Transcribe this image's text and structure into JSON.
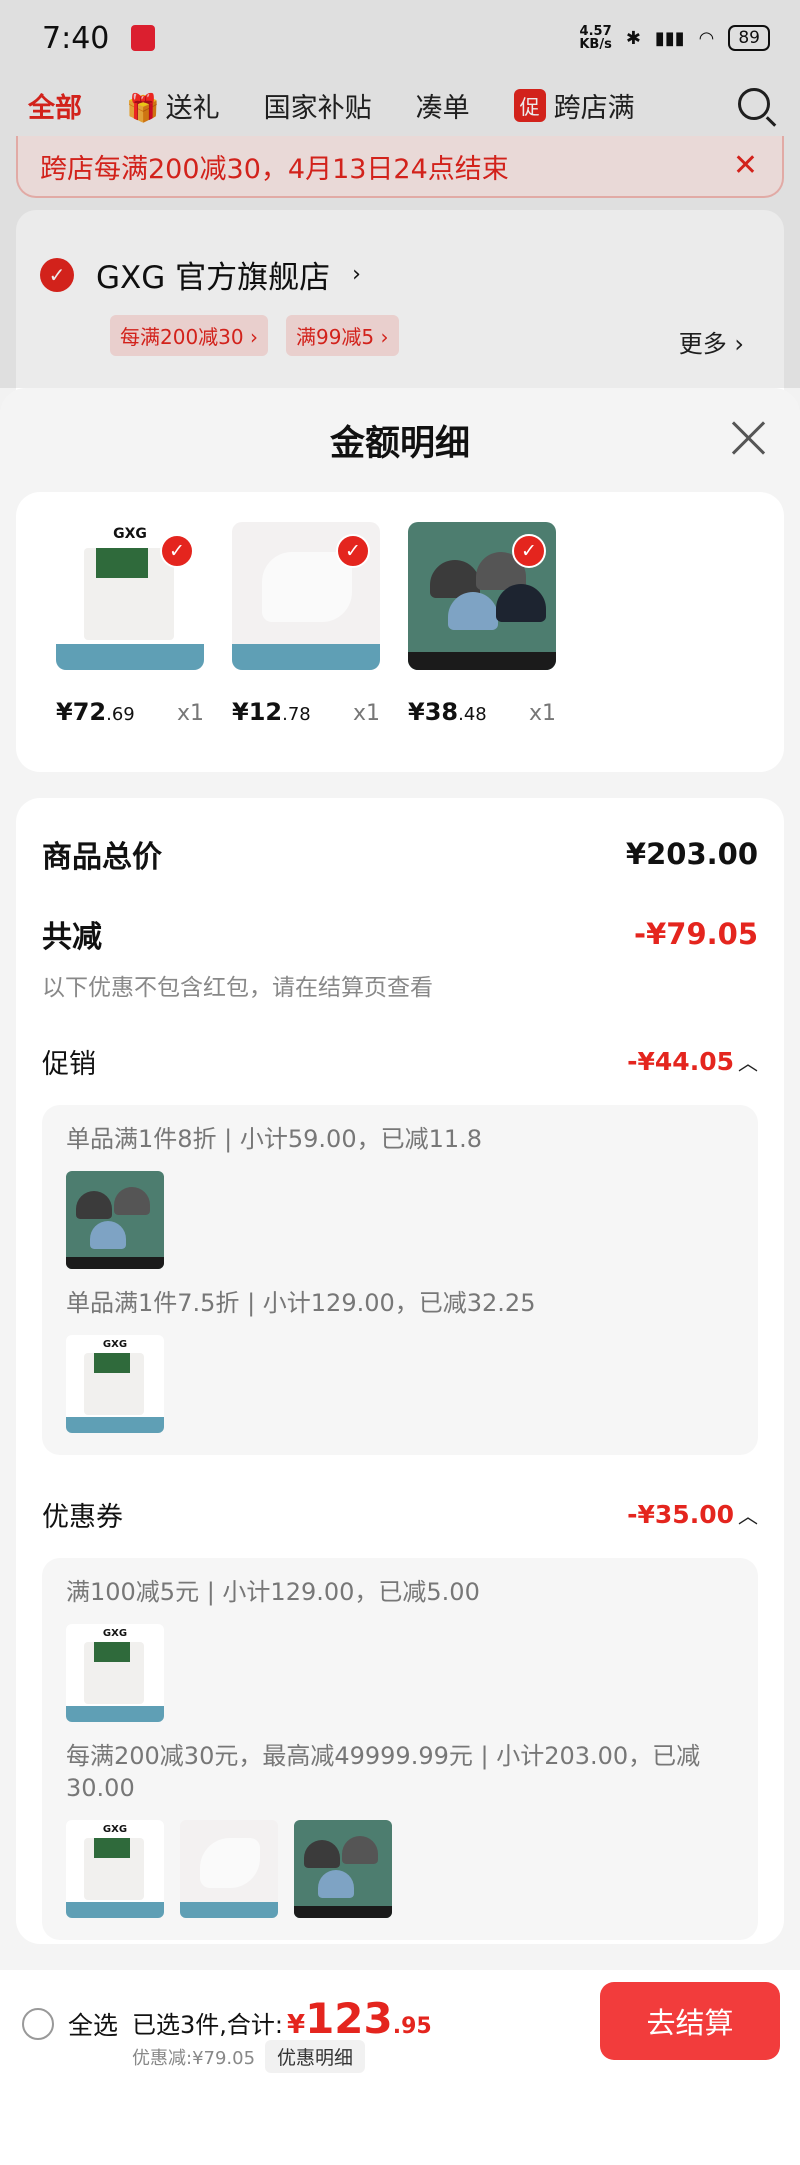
{
  "status_bar": {
    "time": "7:40",
    "speed": "4.57\nKB/s",
    "battery": "89"
  },
  "category_tabs": [
    "全部",
    "送礼",
    "国家补贴",
    "凑单",
    "跨店满"
  ],
  "category_tab_badge": "促",
  "promo_banner": {
    "text": "跨店每满200减30，4月13日24点结束"
  },
  "store": {
    "name": "GXG 官方旗舰店",
    "tags": [
      "每满200减30",
      "满99减5"
    ],
    "more": "更多"
  },
  "sheet": {
    "title": "金额明细",
    "items": [
      {
        "price_int": "¥72",
        "price_dec": ".69",
        "qty": "x1",
        "product": "pants"
      },
      {
        "price_int": "¥12",
        "price_dec": ".78",
        "qty": "x1",
        "product": "socks"
      },
      {
        "price_int": "¥38",
        "price_dec": ".48",
        "qty": "x1",
        "product": "caps"
      }
    ],
    "summary": {
      "total_label": "商品总价",
      "total_value": "¥203.00",
      "discount_label": "共减",
      "discount_value": "-¥79.05",
      "note": "以下优惠不包含红包，请在结算页查看",
      "promotion": {
        "label": "促销",
        "value": "-¥44.05",
        "entries": [
          {
            "text": "单品满1件8折 | 小计59.00，已减11.8"
          },
          {
            "text": "单品满1件7.5折 | 小计129.00，已减32.25"
          }
        ]
      },
      "coupon": {
        "label": "优惠券",
        "value": "-¥35.00",
        "entries": [
          {
            "text": "满100减5元 | 小计129.00，已减5.00"
          },
          {
            "text": "每满200减30元，最高减49999.99元 | 小计203.00，已减30.00"
          }
        ]
      }
    }
  },
  "bottom_bar": {
    "select_all": "全选",
    "selected_text": "已选3件,合计:",
    "total_yen": "¥",
    "total_int": "123",
    "total_dec": ".95",
    "saved": "优惠减:¥79.05",
    "detail_button": "优惠明细",
    "checkout": "去结算"
  },
  "colors": {
    "accent": "#e4251e",
    "checkout": "#f23c3c"
  },
  "icons": [
    "search-icon",
    "close-icon",
    "check-icon",
    "chevron-up-icon",
    "gift-icon",
    "bluetooth-icon",
    "wifi-icon",
    "signal-icon",
    "battery-icon"
  ]
}
